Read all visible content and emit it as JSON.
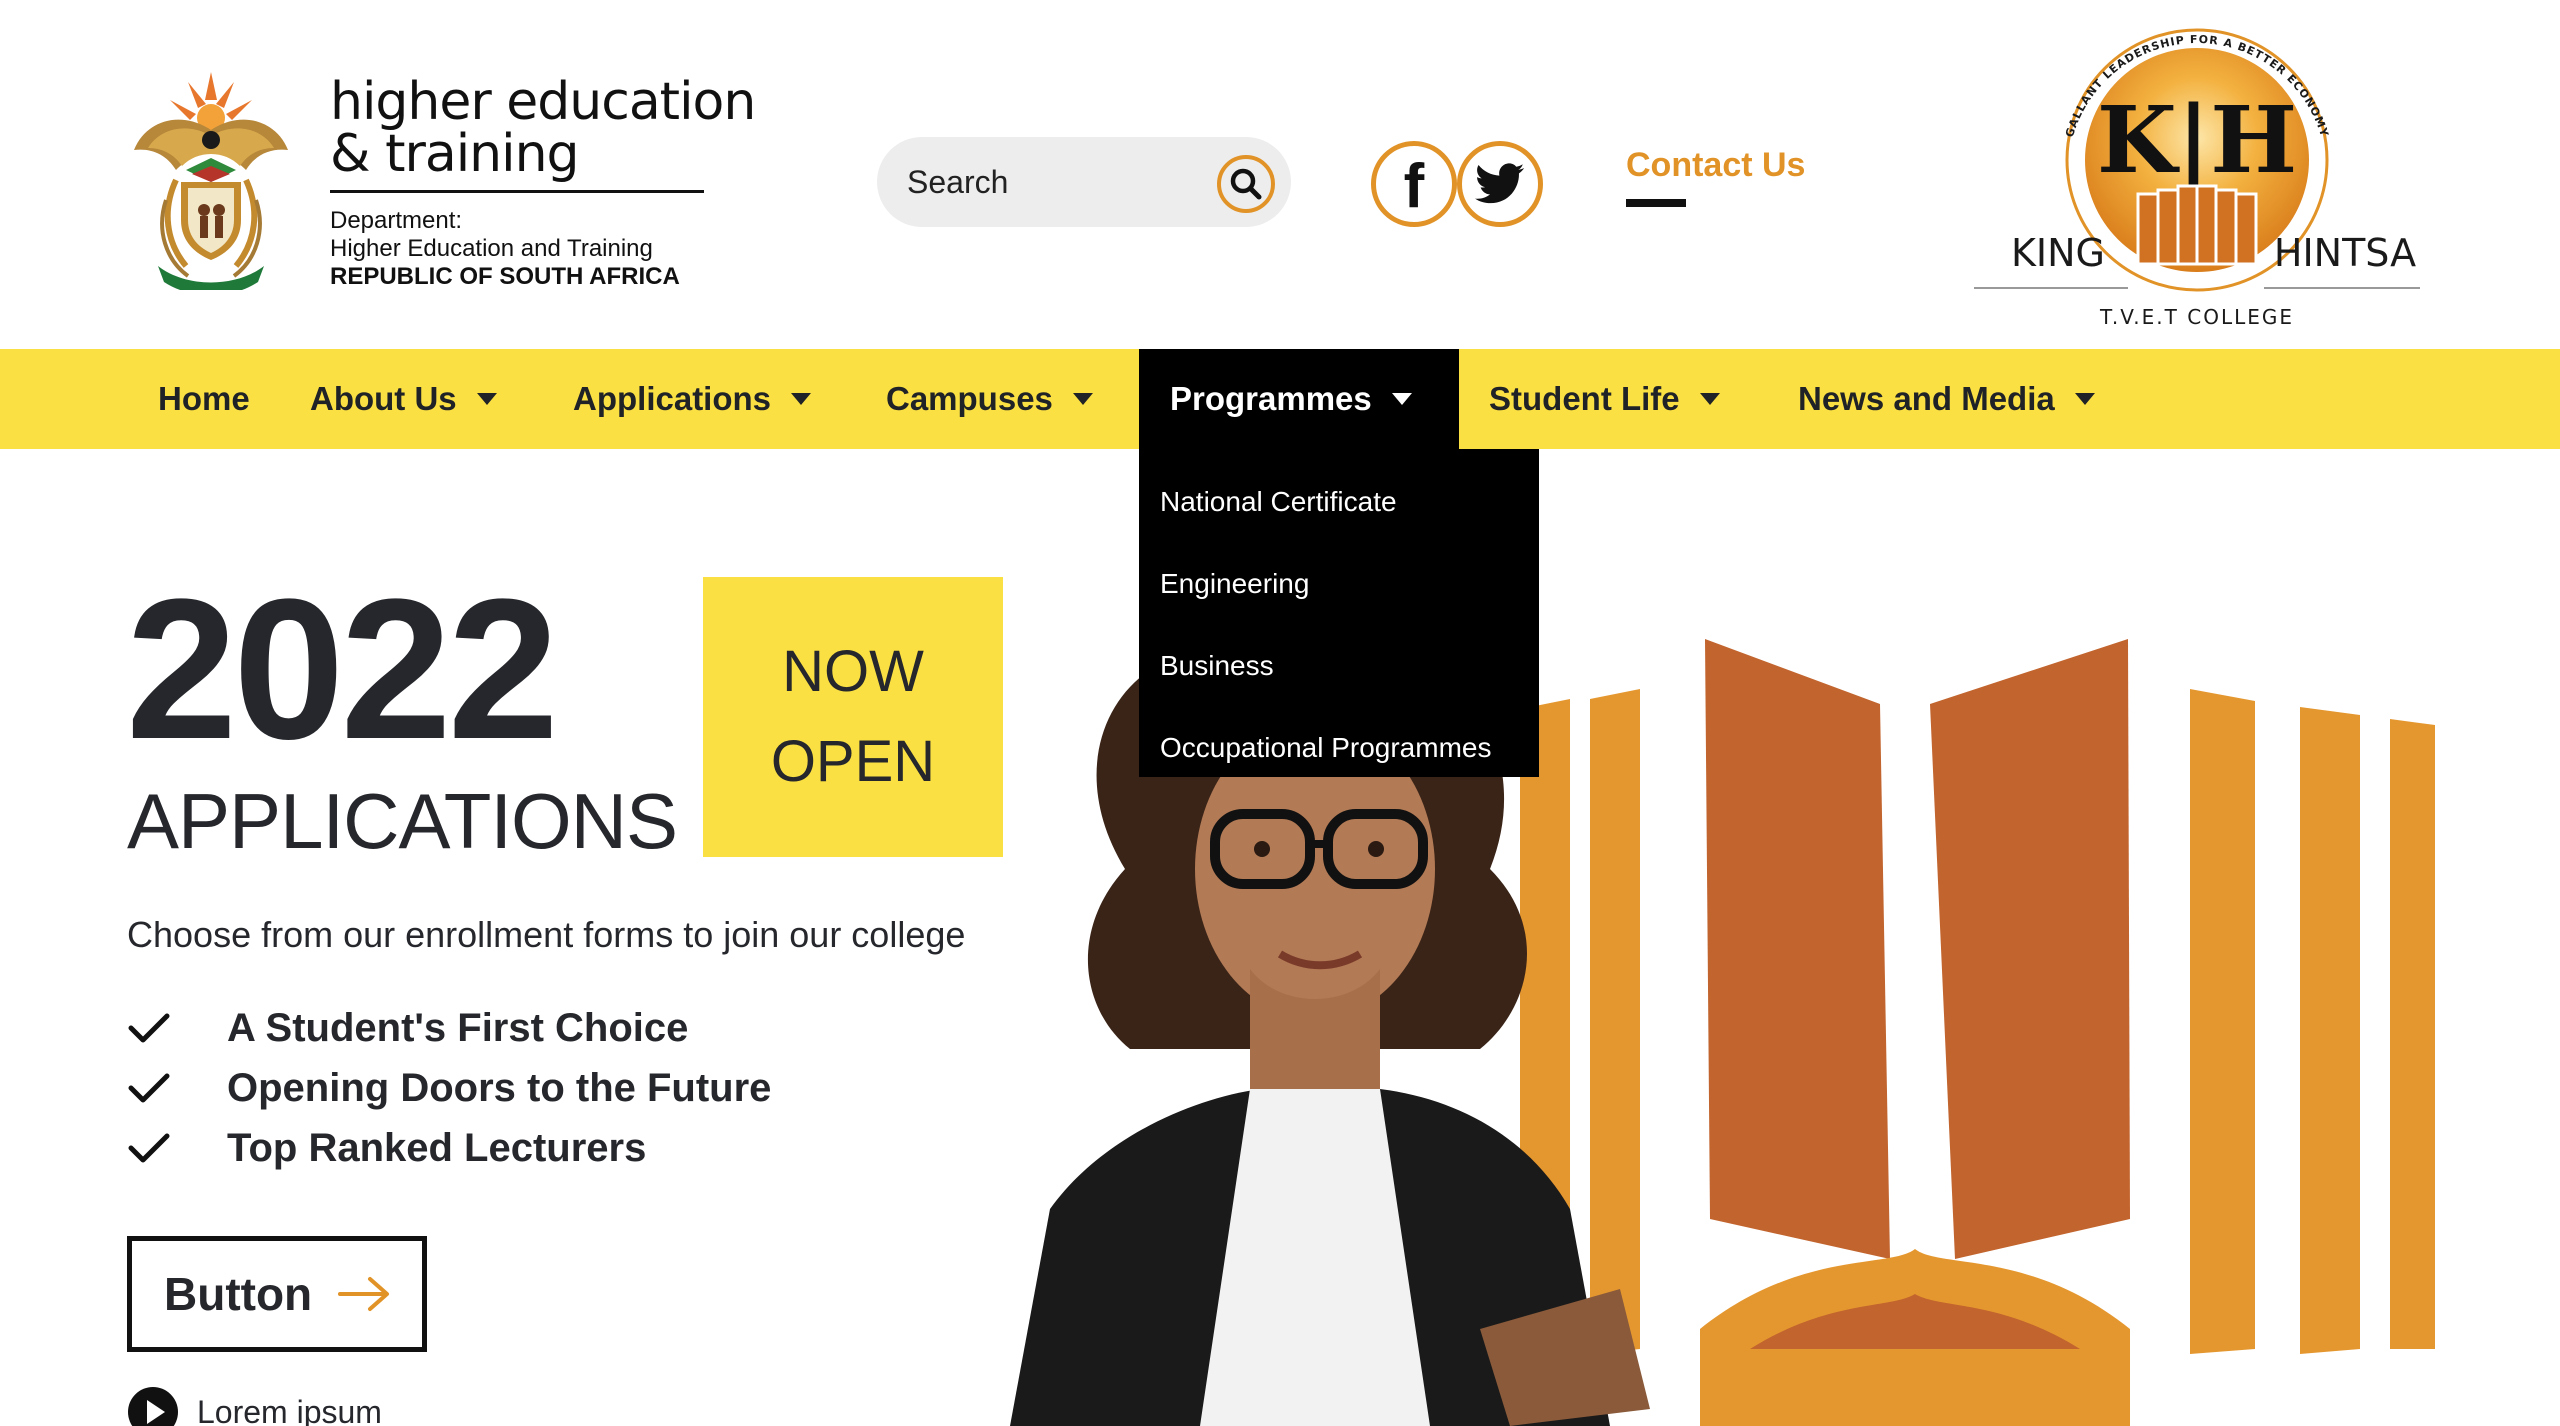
{
  "header": {
    "dept_logo": {
      "title_line1": "higher education",
      "title_line2": "& training",
      "sub_line1": "Department:",
      "sub_line2": "Higher Education and Training",
      "sub_line3": "REPUBLIC OF SOUTH AFRICA",
      "emblem_icon": "coat-of-arms-icon"
    },
    "search": {
      "placeholder": "Search",
      "icon": "search-icon"
    },
    "social": [
      {
        "name": "facebook",
        "icon": "facebook-icon"
      },
      {
        "name": "twitter",
        "icon": "twitter-icon"
      }
    ],
    "contact_label": "Contact Us",
    "college_logo": {
      "monogram": "K|H",
      "arc_text": "GALLANT LEADERSHIP FOR A BETTER ECONOMY",
      "name_left": "KING",
      "name_right": "HINTSA",
      "tagline": "T.V.E.T COLLEGE"
    }
  },
  "nav": {
    "items": [
      {
        "label": "Home",
        "has_caret": false,
        "active": false
      },
      {
        "label": "About Us",
        "has_caret": true,
        "active": false
      },
      {
        "label": "Applications",
        "has_caret": true,
        "active": false
      },
      {
        "label": "Campuses",
        "has_caret": true,
        "active": false
      },
      {
        "label": "Programmes",
        "has_caret": true,
        "active": true
      },
      {
        "label": "Student Life",
        "has_caret": true,
        "active": false
      },
      {
        "label": "News and Media",
        "has_caret": true,
        "active": false
      }
    ],
    "dropdown": [
      {
        "label": "National Certificate"
      },
      {
        "label": "Engineering"
      },
      {
        "label": "Business"
      },
      {
        "label": "Occupational Programmes"
      }
    ]
  },
  "hero": {
    "year": "2022",
    "headline": "APPLICATIONS",
    "badge_line1": "NOW",
    "badge_line2": "OPEN",
    "subtitle": "Choose from our enrollment forms to join our college",
    "checklist": [
      "A Student's First Choice",
      "Opening Doors to the Future",
      "Top Ranked Lecturers"
    ],
    "button_label": "Button",
    "lorem_label": "Lorem ipsum"
  },
  "colors": {
    "accent_orange": "#e19327",
    "nav_yellow": "#fbe043",
    "text_dark": "#25272c",
    "book_orange": "#c2642d",
    "book_light": "#e5972f"
  }
}
